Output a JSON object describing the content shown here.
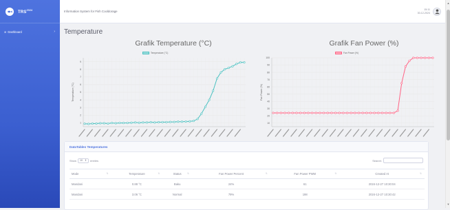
{
  "brand": {
    "name": "TRS",
    "sup": "2024"
  },
  "sidebar": {
    "items": [
      {
        "label": "Dashboard"
      }
    ]
  },
  "topbar": {
    "title": "Information System for Fish Cooldorage",
    "time": "15:11",
    "date": "30-12-2024"
  },
  "page": {
    "title": "Temperature"
  },
  "charts": [
    {
      "title": "Grafik Temperature (°C)",
      "legend": "Temperature (°C)",
      "ylabel": "Temperature (°C)",
      "xlabel": "Created At",
      "color": "#4bc0c0"
    },
    {
      "title": "Grafik Fan Power (%)",
      "legend": "Fan Power (%)",
      "ylabel": "Fan Power (%)",
      "xlabel": "Created At",
      "color": "#ff6384"
    }
  ],
  "chart_data": [
    {
      "type": "line",
      "title": "Grafik Temperature (°C)",
      "xlabel": "Created At",
      "ylabel": "Temperature (°C)",
      "ylim": [
        0.5,
        9.5
      ],
      "yticks": [
        1,
        2,
        3,
        4,
        5,
        6,
        7,
        8,
        9
      ],
      "series": [
        {
          "name": "Temperature (°C)",
          "values": [
            0.88,
            0.86,
            0.9,
            0.9,
            0.95,
            0.95,
            0.92,
            0.98,
            0.95,
            1.0,
            0.98,
            1.0,
            1.02,
            1.05,
            1.02,
            1.05,
            1.05,
            1.08,
            1.05,
            1.08,
            1.1,
            1.1,
            1.12,
            1.12,
            1.15,
            1.15,
            1.18,
            1.2,
            1.25,
            1.5,
            2.2,
            3.1,
            4.0,
            5.2,
            6.8,
            7.6,
            8.0,
            8.2,
            8.4,
            8.7,
            8.9,
            8.9
          ]
        }
      ]
    },
    {
      "type": "line",
      "title": "Grafik Fan Power (%)",
      "xlabel": "Created At",
      "ylabel": "Fan Power (%)",
      "ylim": [
        5,
        100
      ],
      "yticks": [
        10,
        20,
        30,
        40,
        50,
        60,
        70,
        80,
        90,
        100
      ],
      "series": [
        {
          "name": "Fan Power (%)",
          "values": [
            24,
            24,
            24,
            24,
            24,
            24,
            24,
            24,
            24,
            24,
            24,
            24,
            24,
            24,
            24,
            24,
            24,
            24,
            24,
            24,
            24,
            24,
            24,
            24,
            24,
            24,
            24,
            24,
            24,
            24,
            24,
            24,
            27,
            65,
            88,
            96,
            100,
            100,
            100,
            100,
            100,
            100
          ]
        }
      ]
    }
  ],
  "table_card": {
    "title": "DataTables Temperatures",
    "show_label": "Show",
    "entries_value": "10",
    "entries_label": "entries",
    "search_label": "Search:",
    "columns": [
      "Mode",
      "Temperature",
      "Status",
      "Fan Power Percent",
      "Fan Power PWM",
      "Created At"
    ],
    "rows": [
      [
        "Mandani",
        "0.88 °C",
        "Baku",
        "24%",
        "61",
        "2024-12-27 10:30:04"
      ],
      [
        "Mandani",
        "3.06 °C",
        "Normal",
        "79%",
        "198",
        "2024-12-27 10:30:42"
      ]
    ]
  }
}
